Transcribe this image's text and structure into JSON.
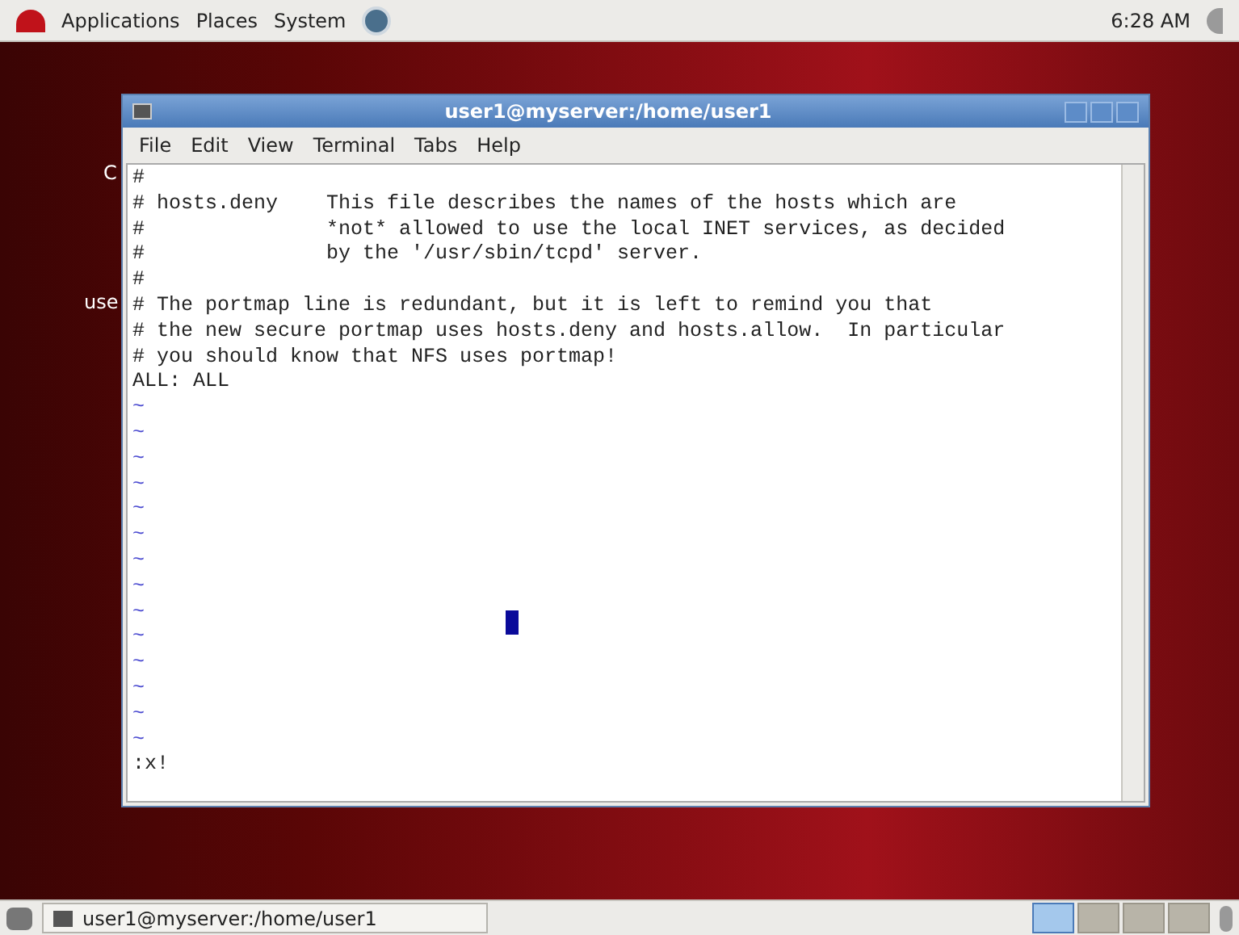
{
  "top_panel": {
    "menus": [
      "Applications",
      "Places",
      "System"
    ],
    "clock": "6:28 AM"
  },
  "desktop_icons": [
    {
      "label": "C"
    },
    {
      "label": "use"
    }
  ],
  "window": {
    "title": "user1@myserver:/home/user1",
    "menu": [
      "File",
      "Edit",
      "View",
      "Terminal",
      "Tabs",
      "Help"
    ],
    "lines": [
      {
        "kind": "text",
        "text": "#"
      },
      {
        "kind": "text",
        "text": "# hosts.deny    This file describes the names of the hosts which are"
      },
      {
        "kind": "text",
        "text": "#               *not* allowed to use the local INET services, as decided"
      },
      {
        "kind": "text",
        "text": "#               by the '/usr/sbin/tcpd' server."
      },
      {
        "kind": "text",
        "text": "#"
      },
      {
        "kind": "text",
        "text": "# The portmap line is redundant, but it is left to remind you that"
      },
      {
        "kind": "text",
        "text": "# the new secure portmap uses hosts.deny and hosts.allow.  In particular"
      },
      {
        "kind": "text",
        "text": "# you should know that NFS uses portmap!"
      },
      {
        "kind": "text",
        "text": "ALL: ALL"
      },
      {
        "kind": "tilde",
        "text": "~"
      },
      {
        "kind": "tilde",
        "text": "~"
      },
      {
        "kind": "tilde",
        "text": "~"
      },
      {
        "kind": "tilde",
        "text": "~"
      },
      {
        "kind": "tilde",
        "text": "~"
      },
      {
        "kind": "tilde",
        "text": "~"
      },
      {
        "kind": "tilde",
        "text": "~"
      },
      {
        "kind": "tilde",
        "text": "~"
      },
      {
        "kind": "tilde",
        "text": "~"
      },
      {
        "kind": "tilde",
        "text": "~"
      },
      {
        "kind": "tilde",
        "text": "~"
      },
      {
        "kind": "tilde",
        "text": "~"
      },
      {
        "kind": "tilde",
        "text": "~"
      },
      {
        "kind": "tilde",
        "text": "~"
      },
      {
        "kind": "text",
        "text": ":x!"
      }
    ]
  },
  "taskbar": {
    "tasks": [
      {
        "label": "user1@myserver:/home/user1",
        "selected": false
      }
    ],
    "workspaces": [
      {
        "selected": true
      },
      {
        "selected": false
      },
      {
        "selected": false
      },
      {
        "selected": false
      }
    ]
  }
}
